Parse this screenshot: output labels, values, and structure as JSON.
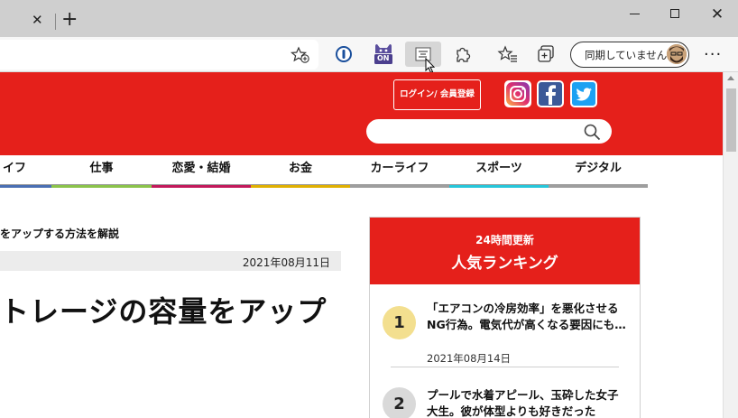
{
  "browser": {
    "tab_close_glyph": "✕",
    "new_tab_glyph": "+",
    "window_controls": {
      "close_glyph": "✕"
    },
    "sync_label": "同期していません",
    "more_glyph": "···",
    "extension_on_badge": "ON",
    "icons": [
      "close-icon",
      "plus-icon",
      "minimize-icon",
      "maximize-icon",
      "favorite-add-icon",
      "1password-icon",
      "on-badge-icon",
      "reader-icon",
      "puzzle-icon",
      "favorites-icon",
      "collections-icon",
      "avatar",
      "more-icon"
    ],
    "accent_color": "#e5201b"
  },
  "site": {
    "login_label": "ログイン/ 会員登録",
    "social_icons": [
      "instagram-icon",
      "facebook-icon",
      "twitter-icon"
    ],
    "nav": [
      {
        "label": "イフ",
        "color": "#4a6fb3"
      },
      {
        "label": "仕事",
        "color": "#8bc34a"
      },
      {
        "label": "恋愛・結婚",
        "color": "#c2185b"
      },
      {
        "label": "お金",
        "color": "#e0b000"
      },
      {
        "label": "カーライフ",
        "color": "#9e9e9e"
      },
      {
        "label": "スポーツ",
        "color": "#26c6da"
      },
      {
        "label": "デジタル",
        "color": "#9e9e9e"
      }
    ]
  },
  "article": {
    "subtitle": "をアップする方法を解説",
    "date": "2021年08月11日",
    "title": "トレージの容量をアップ"
  },
  "ranking": {
    "subtitle": "24時間更新",
    "title": "人気ランキング",
    "items": [
      {
        "rank": "1",
        "text": "「エアコンの冷房効率」を悪化させる NG行為。電気代が高くなる要因にも…",
        "date": "2021年08月14日",
        "badge_color": "#f3df8f"
      },
      {
        "rank": "2",
        "text": "プールで水着アピール、玉砕した女子大生。彼が体型よりも好きだった",
        "date": "",
        "badge_color": "#d9d9d9"
      }
    ]
  }
}
